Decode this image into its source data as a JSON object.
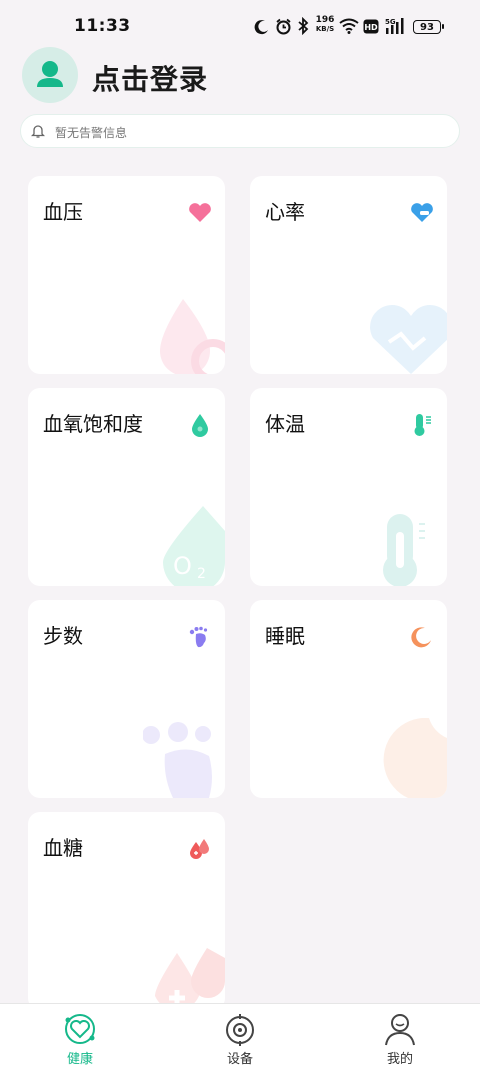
{
  "status_bar": {
    "time": "11:33",
    "net_speed_value": "196",
    "net_speed_unit": "KB/S",
    "battery": "93"
  },
  "profile": {
    "login_label": "点击登录"
  },
  "alert": {
    "text": "暂无告警信息"
  },
  "cards": [
    {
      "title": "血压",
      "icon": "heart-icon"
    },
    {
      "title": "心率",
      "icon": "heart-rate-icon"
    },
    {
      "title": "血氧饱和度",
      "icon": "oxygen-drop-icon"
    },
    {
      "title": "体温",
      "icon": "thermometer-icon"
    },
    {
      "title": "步数",
      "icon": "footprint-icon"
    },
    {
      "title": "睡眠",
      "icon": "moon-icon"
    },
    {
      "title": "血糖",
      "icon": "blood-glucose-icon"
    }
  ],
  "nav": {
    "items": [
      {
        "label": "健康",
        "active": true
      },
      {
        "label": "设备",
        "active": false
      },
      {
        "label": "我的",
        "active": false
      }
    ],
    "active_color": "#15b88a",
    "inactive_color": "#333333"
  },
  "colors": {
    "accent": "#15b88a",
    "background": "#f6f3f6"
  }
}
